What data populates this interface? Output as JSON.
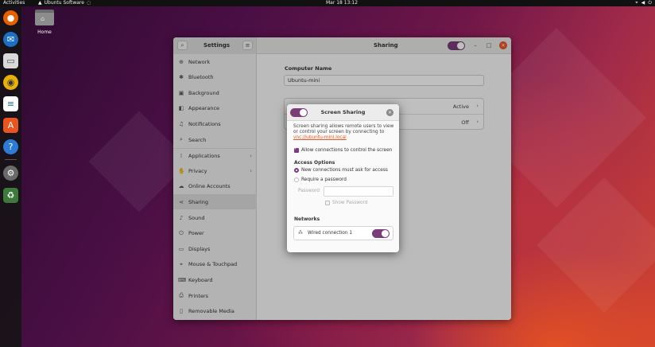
{
  "topbar": {
    "activities": "Activities",
    "app_name": "Ubuntu Software",
    "clock": "Mar 18  13:12"
  },
  "desktop": {
    "home_label": "Home"
  },
  "dock": {
    "items": [
      "firefox-icon",
      "thunderbird-icon",
      "files-icon",
      "rhythmbox-icon",
      "writer-icon",
      "software-icon",
      "help-icon",
      "settings-icon",
      "trash-icon"
    ]
  },
  "window": {
    "sidebar_title": "Settings",
    "panel_title": "Sharing",
    "sharing_enabled": true
  },
  "sidebar": {
    "items": [
      {
        "label": "Network",
        "icon": "network-icon"
      },
      {
        "label": "Bluetooth",
        "icon": "bluetooth-icon"
      },
      {
        "label": "Background",
        "icon": "background-icon"
      },
      {
        "label": "Appearance",
        "icon": "appearance-icon"
      },
      {
        "label": "Notifications",
        "icon": "bell-icon"
      },
      {
        "label": "Search",
        "icon": "search-icon"
      },
      {
        "label": "Applications",
        "icon": "apps-icon"
      },
      {
        "label": "Privacy",
        "icon": "hand-icon"
      },
      {
        "label": "Online Accounts",
        "icon": "cloud-icon"
      },
      {
        "label": "Sharing",
        "icon": "share-icon"
      },
      {
        "label": "Sound",
        "icon": "music-icon"
      },
      {
        "label": "Power",
        "icon": "power-icon"
      },
      {
        "label": "Displays",
        "icon": "display-icon"
      },
      {
        "label": "Mouse & Touchpad",
        "icon": "mouse-icon"
      },
      {
        "label": "Keyboard",
        "icon": "keyboard-icon"
      },
      {
        "label": "Printers",
        "icon": "printer-icon"
      },
      {
        "label": "Removable Media",
        "icon": "media-icon"
      }
    ],
    "active": "Sharing"
  },
  "content": {
    "computer_name_label": "Computer Name",
    "computer_name_value": "Ubuntu-mini",
    "services": [
      {
        "status": "Active"
      },
      {
        "status": "Off"
      }
    ]
  },
  "dialog": {
    "title": "Screen Sharing",
    "enabled": true,
    "description": "Screen sharing allows remote users to view or control your screen by connecting to",
    "link": "vnc://ubuntu-mini.local",
    "allow_control_label": "Allow connections to control the screen",
    "allow_control_checked": true,
    "access_options_label": "Access Options",
    "option_ask": "New connections must ask for access",
    "option_password": "Require a password",
    "password_label": "Password",
    "password_value": "",
    "show_password_label": "Show Password",
    "networks_label": "Networks",
    "network_name": "Wired connection 1",
    "network_enabled": true
  }
}
